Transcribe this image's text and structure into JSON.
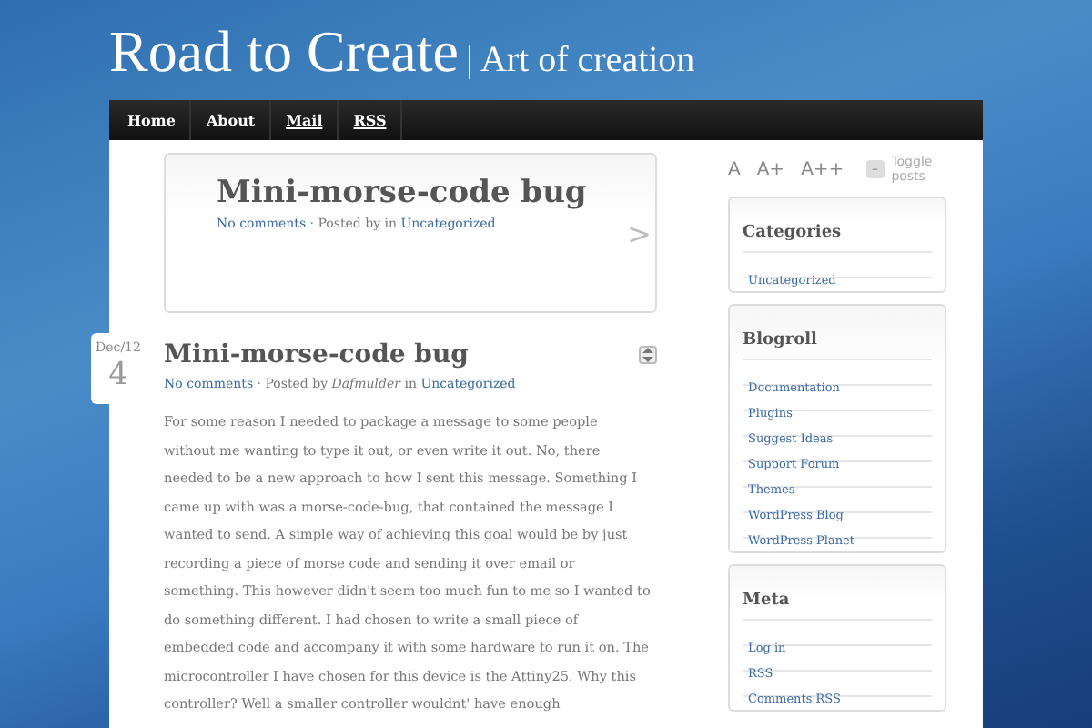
{
  "site": {
    "title": "Road to Create",
    "separator": "|",
    "tagline": "Art of creation"
  },
  "nav": [
    {
      "label": "Home",
      "underlined": false
    },
    {
      "label": "About",
      "underlined": false
    },
    {
      "label": "Mail",
      "underlined": true
    },
    {
      "label": "RSS",
      "underlined": true
    }
  ],
  "featured": {
    "title": "Mini-morse-code bug",
    "comments": "No comments",
    "posted": "· Posted by in",
    "category": "Uncategorized",
    "next": ">"
  },
  "post": {
    "date_month": "Dec/12",
    "date_day": "4",
    "title": "Mini-morse-code bug",
    "comments": "No comments",
    "posted_by": "· Posted by",
    "author": "Dafmulder",
    "in": "in",
    "category": "Uncategorized",
    "body_lines": [
      "For some reason I needed to package a message to some people",
      "without me wanting to type it out, or even write it out. No, there",
      "needed to be a new approach to how I sent this message. Something I",
      "came up with was a morse-code-bug, that contained the message I",
      "wanted to send. A simple way of achieving this goal would be by just",
      "recording a piece of morse code and sending it over email or",
      "something. This however didn't seem too much fun to me so I wanted to",
      "do something different. I had chosen to write a small piece of",
      "embedded code and accompany it with some hardware to run it on. The",
      "microcontroller I have chosen for this device is the Attiny25. Why this",
      "controller? Well a smaller controller wouldnt' have enough"
    ]
  },
  "font_controls": [
    "A",
    "A+",
    "A++"
  ],
  "toggle": {
    "icon": "–",
    "label": "Toggle posts"
  },
  "widgets": [
    {
      "title": "Categories",
      "links": [
        "Uncategorized"
      ]
    },
    {
      "title": "Blogroll",
      "links": [
        "Documentation",
        "Plugins",
        "Suggest Ideas",
        "Support Forum",
        "Themes",
        "WordPress Blog",
        "WordPress Planet"
      ]
    },
    {
      "title": "Meta",
      "links": [
        "Log in",
        "RSS",
        "Comments RSS"
      ]
    }
  ]
}
